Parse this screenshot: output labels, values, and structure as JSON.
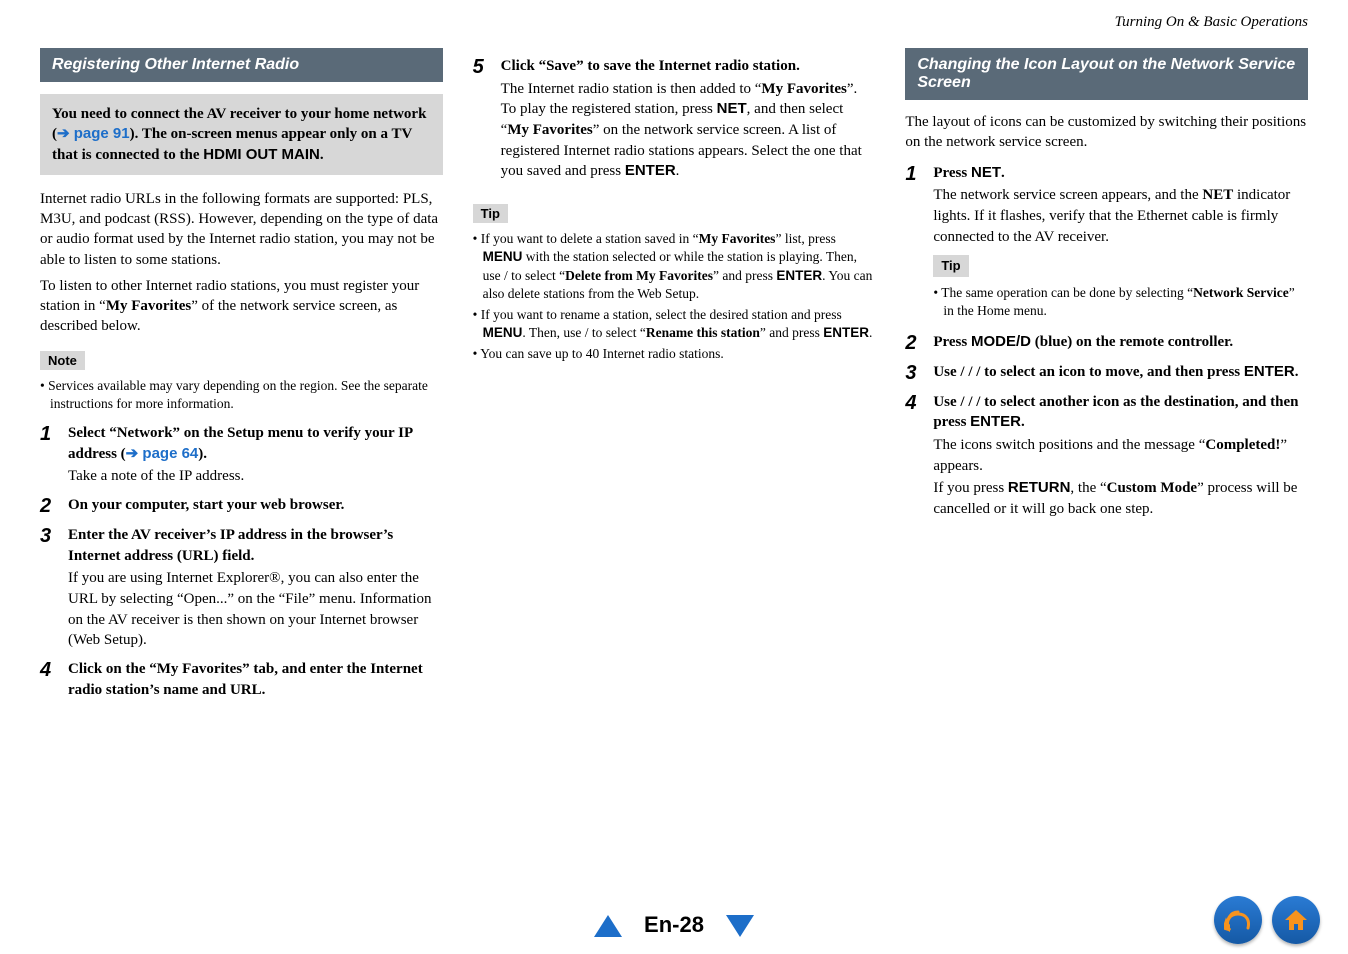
{
  "breadcrumb": "Turning On & Basic Operations",
  "col1": {
    "heading": "Registering Other Internet Radio",
    "callout": {
      "pre": "You need to connect the AV receiver to your home network (",
      "arrow": "➔ ",
      "link": "page 91",
      "mid": "). The on-screen menus appear only on a TV that is connected to the ",
      "hdmi": "HDMI OUT MAIN",
      "post": "."
    },
    "intro1": "Internet radio URLs in the following formats are supported: PLS, M3U, and podcast (RSS). However, depending on the type of data or audio format used by the Internet radio station, you may not be able to listen to some stations.",
    "intro2_pre": "To listen to other Internet radio stations, you must register your station in “",
    "intro2_bold": "My Favorites",
    "intro2_post": "” of the network service screen, as described below.",
    "noteLabel": "Note",
    "noteBullet": "Services available may vary depending on the region. See the separate instructions for more information.",
    "step1": {
      "title_pre": "Select “Network” on the Setup menu to verify your IP address (",
      "title_arrow": "➔ ",
      "title_link": "page 64",
      "title_post": ").",
      "text": "Take a note of the IP address."
    },
    "step2": {
      "title": "On your computer, start your web browser."
    },
    "step3": {
      "title": "Enter the AV receiver’s IP address in the browser’s Internet address (URL) field.",
      "text": "If you are using Internet Explorer®, you can also enter the URL by selecting “Open...” on the “File” menu. Information on the AV receiver is then shown on your Internet browser (Web Setup)."
    },
    "step4": {
      "title": "Click on the “My Favorites” tab, and enter the Internet radio station’s name and URL."
    }
  },
  "col2": {
    "step5": {
      "title": "Click “Save” to save the Internet radio station.",
      "t1_pre": "The Internet radio station is then added to “",
      "t1_b1": "My Favorites",
      "t1_mid": "”. To play the registered station, press ",
      "t1_net": "NET",
      "t1_mid2": ", and then select “",
      "t1_b2": "My Favorites",
      "t1_post": "” on the network service screen. A list of registered Internet radio stations appears. Select the one that you saved and press ",
      "t1_enter": "ENTER",
      "t1_end": "."
    },
    "tipLabel": "Tip",
    "tip1": {
      "a": "If you want to delete a station saved in “",
      "b": "My Favorites",
      "c": "” list, press ",
      "menu": "MENU",
      "d": " with the station selected or while the station is playing. Then, use   /   to select “",
      "del": "Delete from My Favorites",
      "e": "” and press ",
      "enter": "ENTER",
      "f": ". You can also delete stations from the Web Setup."
    },
    "tip2": {
      "a": "If you want to rename a station, select the desired station and press ",
      "menu": "MENU",
      "b": ". Then, use   /   to select “",
      "ren": "Rename this station",
      "c": "” and press ",
      "enter": "ENTER",
      "d": "."
    },
    "tip3": "You can save up to 40 Internet radio stations."
  },
  "col3": {
    "heading": "Changing the Icon Layout on the Network Service Screen",
    "para": "The layout of icons can be customized by switching their positions on the network service screen.",
    "step1": {
      "title_pre": "Press ",
      "title_net": "NET",
      "title_post": ".",
      "t_pre": "The network service screen appears, and the ",
      "t_net": "NET",
      "t_post": " indicator lights. If it flashes, verify that the Ethernet cable is firmly connected to the AV receiver."
    },
    "tipLabel": "Tip",
    "tipb": {
      "a": "The same operation can be done by selecting “",
      "b": "Network Service",
      "c": "” in the Home menu."
    },
    "step2": {
      "pre": "Press ",
      "mode": "MODE/D",
      "post": " (blue) on the remote controller."
    },
    "step3": {
      "pre": "Use   /   /   /   to select an icon to move, and then press ",
      "enter": "ENTER",
      "post": "."
    },
    "step4": {
      "title_pre": "Use   /   /   /   to select another icon as the destination, and then press ",
      "title_enter": "ENTER",
      "title_post": ".",
      "t1_pre": "The icons switch positions and the message “",
      "t1_b": "Completed!",
      "t1_post": "” appears.",
      "t2_pre": "If you press ",
      "t2_ret": "RETURN",
      "t2_mid": ", the “",
      "t2_b": "Custom Mode",
      "t2_post": "” process will be cancelled or it will go back one step."
    }
  },
  "footer": {
    "page": "En-28"
  }
}
